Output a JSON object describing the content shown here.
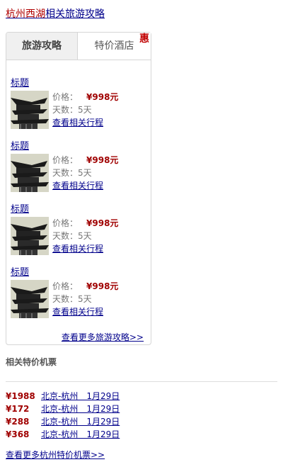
{
  "header": {
    "link_highlight": "杭州西湖",
    "link_rest": "相关旅游攻略"
  },
  "tabs": {
    "active": "旅游攻略",
    "inactive": "特价酒店",
    "badge": "惠"
  },
  "items": [
    {
      "title": "标题",
      "price_label": "价格：",
      "price": "¥998元",
      "days": "天数：5天",
      "link": "查看相关行程"
    },
    {
      "title": "标题",
      "price_label": "价格：",
      "price": "¥998元",
      "days": "天数：5天",
      "link": "查看相关行程"
    },
    {
      "title": "标题",
      "price_label": "价格：",
      "price": "¥998元",
      "days": "天数：5天",
      "link": "查看相关行程"
    },
    {
      "title": "标题",
      "price_label": "价格：",
      "price": "¥998元",
      "days": "天数：5天",
      "link": "查看相关行程"
    }
  ],
  "card_more": "查看更多旅游攻略>>",
  "tickets_section": {
    "title": "相关特价机票",
    "tickets": [
      {
        "price": "¥1988",
        "route": "北京-杭州　1月29日"
      },
      {
        "price": "¥172",
        "route": "北京-杭州　1月29日"
      },
      {
        "price": "¥288",
        "route": "北京-杭州　1月29日"
      },
      {
        "price": "¥368",
        "route": "北京-杭州　1月29日"
      }
    ],
    "more": "查看更多杭州特价机票>>"
  }
}
